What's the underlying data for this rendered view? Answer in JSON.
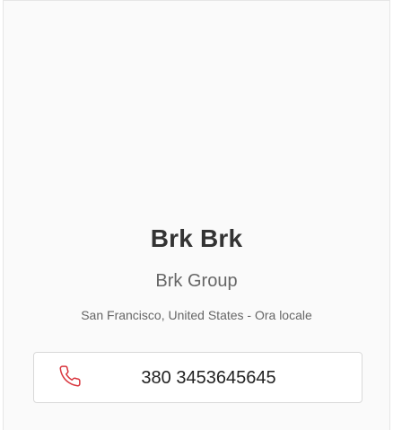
{
  "profile": {
    "name": "Brk Brk",
    "company": "Brk Group",
    "location": "San Francisco, United States - Ora locale"
  },
  "contact": {
    "phone": "380 3453645645",
    "icon": "phone-icon",
    "icon_color": "#d9363e"
  }
}
